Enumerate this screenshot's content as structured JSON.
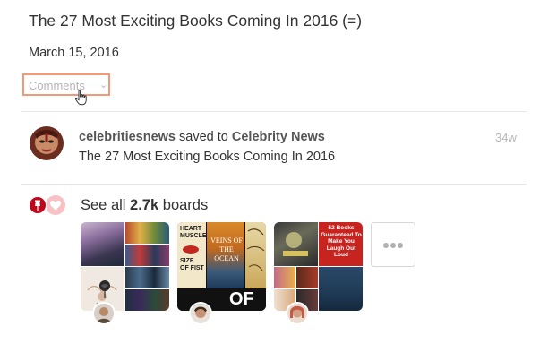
{
  "pin": {
    "title": "The 27 Most Exciting Books Coming In 2016 (=)",
    "date": "March 15, 2016"
  },
  "comments": {
    "label": "Comments",
    "chevron_icon": "chevron-down-icon"
  },
  "activity": {
    "user": "celebritiesnews",
    "action": "saved to",
    "board": "Celebrity News",
    "time": "34w",
    "pin_title": "The 27 Most Exciting Books Coming In 2016"
  },
  "boards_section": {
    "see_all_prefix": "See all",
    "count": "2.7k",
    "suffix": "boards",
    "save_icon": "pushpin-icon",
    "like_icon": "heart-icon",
    "more_icon": "ellipsis-icon"
  },
  "board_covers": [
    {
      "heart_muscle_text": "HEART MUSCLE",
      "fist_text": "SIZE OF FIST",
      "veins_text": "VEINS OF THE OCEAN",
      "bottom_text": "OF"
    },
    {
      "book_title": "52 Books Guaranteed To Make You Laugh Out Loud"
    }
  ],
  "colors": {
    "accent": "#bd081c",
    "comments_border": "#f29a78",
    "muted_text": "#b5b5b5"
  }
}
